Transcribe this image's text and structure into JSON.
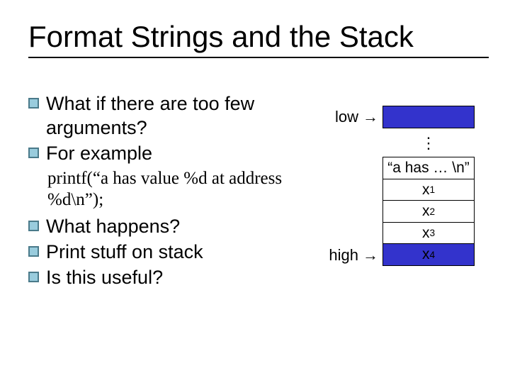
{
  "title": "Format Strings and the Stack",
  "bullets": {
    "b1": "What if there are too few arguments?",
    "b2": "For example",
    "code": "printf(“a has value %d at address %d\\n”);",
    "b3": "What happens?",
    "b4": "Print stuff on stack",
    "b5": "Is this useful?"
  },
  "stack": {
    "low_label": "low",
    "high_label": "high",
    "arrow": "→",
    "vdots": "⋮",
    "cells": {
      "top_blank": "",
      "fmt": "“a has … \\n”",
      "x1_base": "x",
      "x1_sub": "1",
      "x2_base": "x",
      "x2_sub": "2",
      "x3_base": "x",
      "x3_sub": "3",
      "x4_base": "x",
      "x4_sub": "4"
    }
  }
}
